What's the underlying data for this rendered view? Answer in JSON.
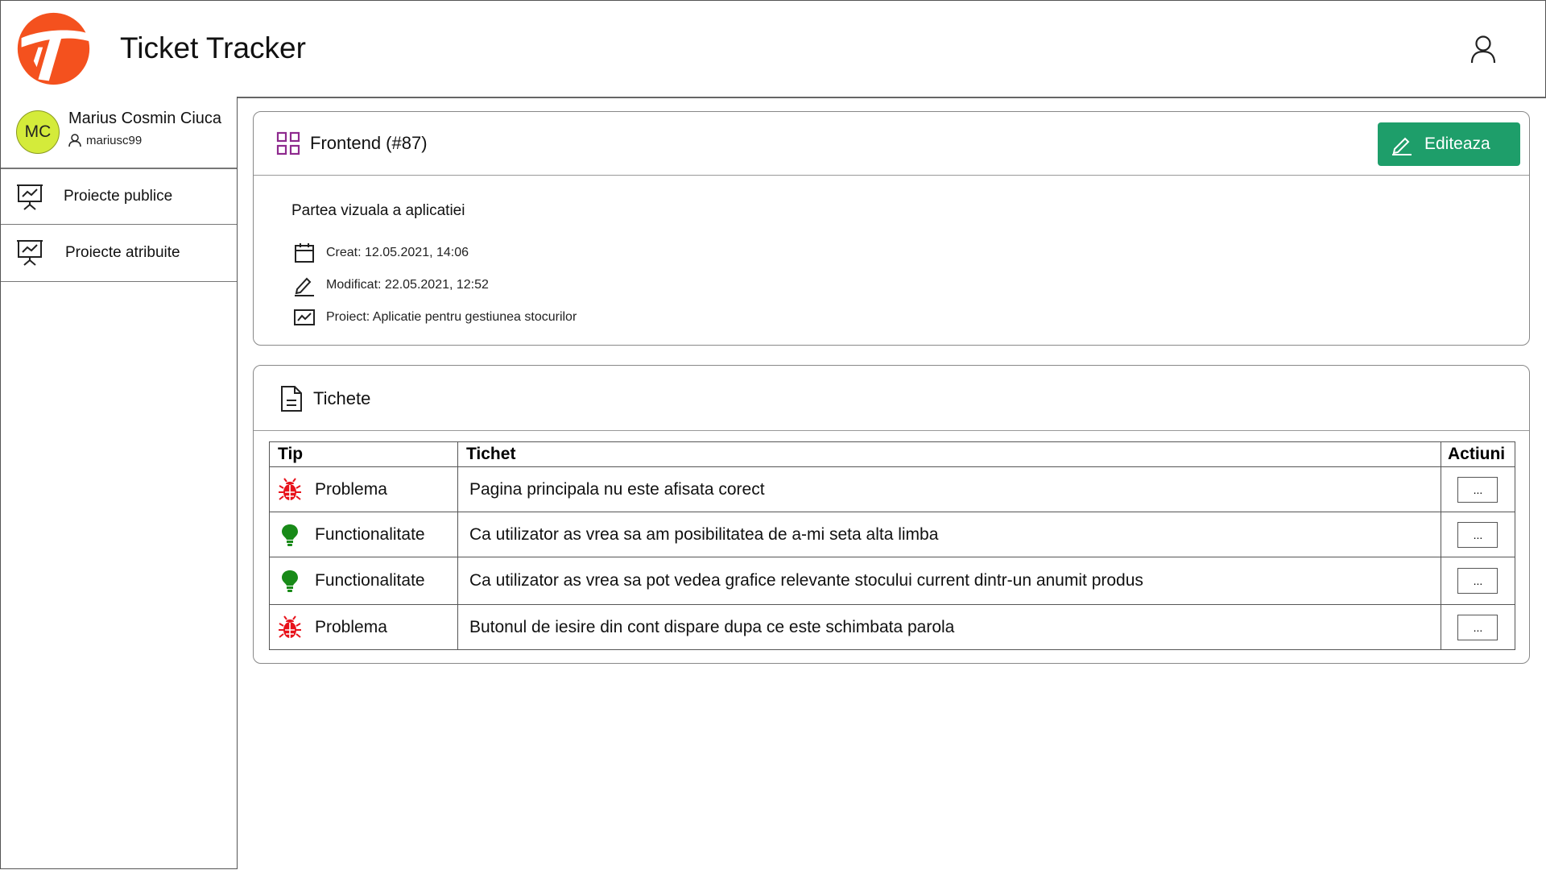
{
  "app": {
    "title": "Ticket Tracker",
    "brand_color": "#f4511e"
  },
  "profile": {
    "initials": "MC",
    "name": "Marius Cosmin Ciuca",
    "username": "mariusc99",
    "avatar_color": "#d4eb3a"
  },
  "sidebar": {
    "items": [
      {
        "label": "Proiecte publice",
        "icon": "presentation-chart-icon"
      },
      {
        "label": "Proiecte atribuite",
        "icon": "presentation-chart-icon"
      }
    ]
  },
  "project": {
    "title": "Frontend (#87)",
    "edit_label": "Editeaza",
    "accent_color": "#1e9e6a",
    "description": "Partea vizuala a aplicatiei",
    "created": "Creat: 12.05.2021, 14:06",
    "modified": "Modificat: 22.05.2021, 12:52",
    "project_name": "Proiect: Aplicatie pentru gestiunea stocurilor"
  },
  "tickets": {
    "title": "Tichete",
    "columns": {
      "type": "Tip",
      "ticket": "Tichet",
      "actions": "Actiuni"
    },
    "more_label": "...",
    "rows": [
      {
        "type": "Problema",
        "icon": "bug-icon",
        "text": "Pagina principala nu este afisata corect"
      },
      {
        "type": "Functionalitate",
        "icon": "lightbulb-icon",
        "text": "Ca utilizator as vrea sa am posibilitatea de a-mi seta alta limba"
      },
      {
        "type": "Functionalitate",
        "icon": "lightbulb-icon",
        "text": "Ca utilizator as vrea sa pot vedea grafice relevante stocului current dintr-un anumit produs"
      },
      {
        "type": "Problema",
        "icon": "bug-icon",
        "text": "Butonul de iesire din cont dispare dupa ce este schimbata parola"
      }
    ]
  }
}
